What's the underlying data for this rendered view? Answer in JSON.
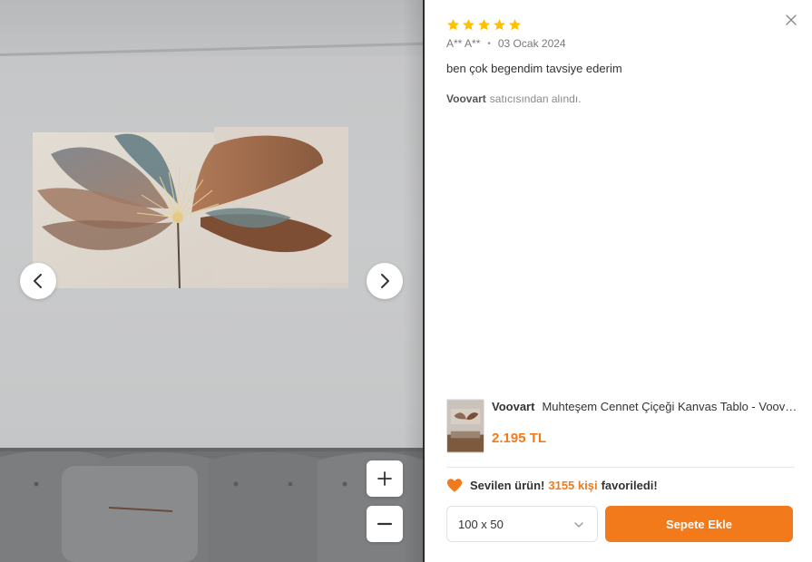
{
  "review": {
    "rating": 5,
    "author": "A** A**",
    "date": "03 Ocak 2024",
    "comment": "ben çok begendim tavsiye ederim",
    "seller_name": "Voovart",
    "seller_suffix": "satıcısından alındı."
  },
  "gallery": {
    "prev_icon": "chevron-left-icon",
    "next_icon": "chevron-right-icon",
    "zoom_in_icon": "plus-icon",
    "zoom_out_icon": "minus-icon"
  },
  "product": {
    "brand": "Voovart",
    "title": "Muhteşem Cennet Çiçeği Kanvas Tablo - Voov2...",
    "price": "2.195 TL"
  },
  "favorite": {
    "prefix": "Sevilen ürün!",
    "count": "3155 kişi",
    "suffix": "favoriledi!"
  },
  "actions": {
    "size_value": "100 x 50",
    "add_to_cart": "Sepete Ekle"
  },
  "colors": {
    "accent": "#f27a1a",
    "star": "#ffc000"
  }
}
